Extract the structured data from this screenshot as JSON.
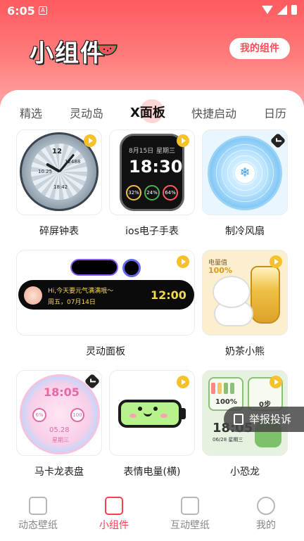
{
  "status_bar": {
    "time": "6:05",
    "notification_badge": "A"
  },
  "header": {
    "app_title": "小组件",
    "my_widgets_button": "我的组件"
  },
  "tabs": [
    {
      "label": "精选",
      "active": false
    },
    {
      "label": "灵动岛",
      "active": false
    },
    {
      "label": "X面板",
      "active": true
    },
    {
      "label": "快捷启动",
      "active": false
    },
    {
      "label": "日历",
      "active": false
    }
  ],
  "widgets": [
    {
      "label": "碎屏钟表",
      "badge": "play",
      "face_numbers": [
        "12",
        "10.25",
        "12488",
        "18:42"
      ]
    },
    {
      "label": "ios电子手表",
      "badge": "play",
      "date": "8月15日",
      "weekday": "星期三",
      "time": "18:30",
      "gauges": [
        "32%",
        "24%",
        "64%"
      ]
    },
    {
      "label": "制冷风扇",
      "badge": "vip"
    },
    {
      "label": "灵动面板",
      "badge": "play",
      "message": "Hi,今天要元气满满哦～",
      "date": "周五，07月14日",
      "time": "12:00"
    },
    {
      "label": "奶茶小熊",
      "badge": "play",
      "battery_label": "电量值",
      "battery_value": "100%"
    },
    {
      "label": "马卡龙表盘",
      "badge": "vip",
      "time": "18:05",
      "date": "05.28",
      "weekday": "星期三",
      "sub_left": "6%",
      "sub_right": "100"
    },
    {
      "label": "表情电量(横)",
      "badge": "play"
    },
    {
      "label": "小恐龙",
      "badge": "play",
      "battery_value": "100%",
      "steps": "0步",
      "time": "18:05",
      "date": "06/28 星期三"
    }
  ],
  "report_button": "举报投诉",
  "bottom_nav": [
    {
      "label": "动态壁纸",
      "icon": "image-icon",
      "active": false
    },
    {
      "label": "小组件",
      "icon": "widgets-icon",
      "active": true
    },
    {
      "label": "互动壁纸",
      "icon": "interactive-wallpaper-icon",
      "active": false
    },
    {
      "label": "我的",
      "icon": "profile-icon",
      "active": false
    }
  ],
  "colors": {
    "accent": "#ff3e4d",
    "header_gradient_top": "#ff5a5f",
    "play_badge": "#f7c12a"
  }
}
